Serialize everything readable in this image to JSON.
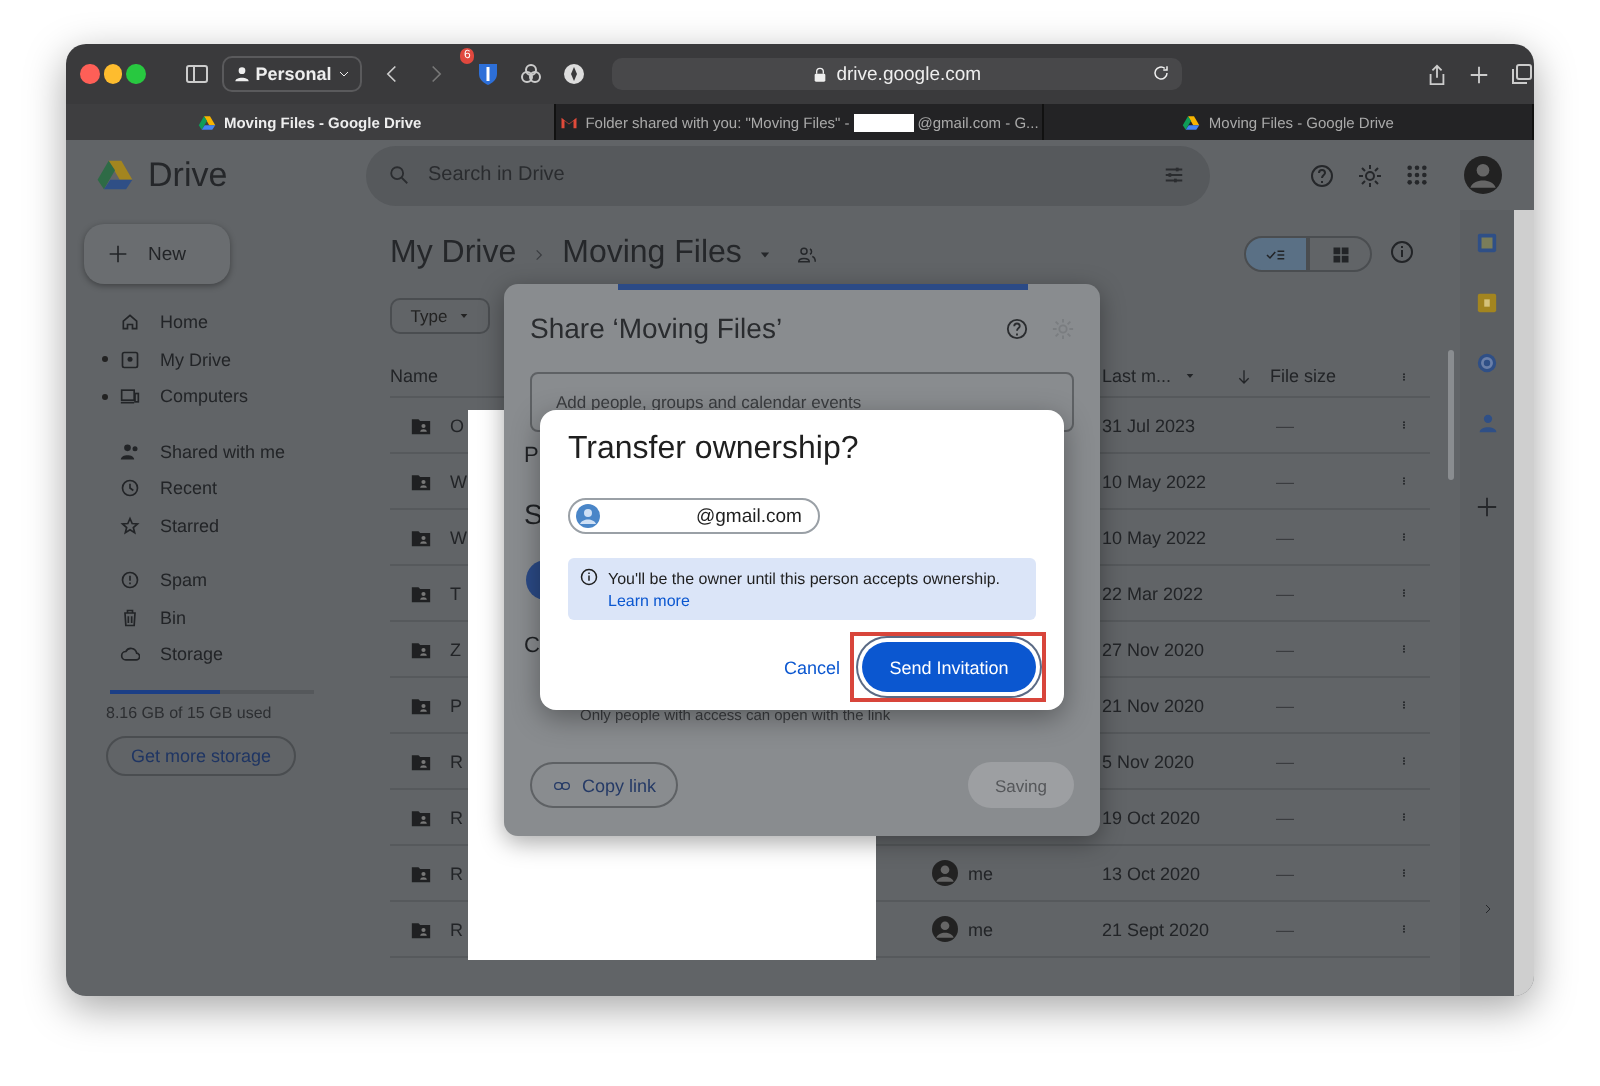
{
  "browser": {
    "profile": "Personal",
    "extension_badge": "6",
    "address": "drive.google.com"
  },
  "tabs": [
    {
      "title": "Moving Files - Google Drive",
      "selected": true
    },
    {
      "title": "Folder shared with you: \"Moving Files\" -",
      "title_after_redaction": "@gmail.com - G...",
      "selected": false
    },
    {
      "title": "Moving Files - Google Drive",
      "selected": false
    }
  ],
  "drive": {
    "app_name": "Drive",
    "search_placeholder": "Search in Drive",
    "new_button": "New",
    "nav_groups": [
      [
        {
          "label": "Home",
          "has_children": false
        },
        {
          "label": "My Drive",
          "has_children": true
        },
        {
          "label": "Computers",
          "has_children": true
        }
      ],
      [
        {
          "label": "Shared with me",
          "has_children": false
        },
        {
          "label": "Recent",
          "has_children": false
        },
        {
          "label": "Starred",
          "has_children": false
        }
      ],
      [
        {
          "label": "Spam",
          "has_children": false
        },
        {
          "label": "Bin",
          "has_children": false
        },
        {
          "label": "Storage",
          "has_children": false
        }
      ]
    ],
    "storage": {
      "level": 0.54,
      "usage": "8.16 GB of 15 GB used",
      "button": "Get more storage"
    },
    "breadcrumb": [
      "My Drive",
      "Moving Files"
    ],
    "filter": "Type",
    "views": [
      {
        "selected": true
      },
      {
        "selected": false
      }
    ],
    "columns": {
      "name": "Name",
      "modified": "Last m...",
      "size": "File size"
    },
    "rows": [
      {
        "name": "O",
        "modified": "31 Jul 2023",
        "size": "—"
      },
      {
        "name": "W",
        "modified": "10 May 2022",
        "size": "—"
      },
      {
        "name": "W",
        "modified": "10 May 2022",
        "size": "—"
      },
      {
        "name": "T",
        "modified": "22 Mar 2022",
        "size": "—"
      },
      {
        "name": "Z",
        "modified": "27 Nov 2020",
        "size": "—"
      },
      {
        "name": "P",
        "modified": "21 Nov 2020",
        "size": "—"
      },
      {
        "name": "R",
        "modified": "5 Nov 2020",
        "size": "—"
      },
      {
        "name": "R",
        "modified": "19 Oct 2020",
        "size": "—"
      },
      {
        "name": "R",
        "owner": "me",
        "modified": "13 Oct 2020",
        "size": "—"
      },
      {
        "name": "R",
        "owner": "me",
        "modified": "21 Sept 2020",
        "size": "—"
      }
    ]
  },
  "share_dialog": {
    "title": "Share ‘Moving Files’",
    "add_placeholder": "Add people, groups and calendar events",
    "loading": true,
    "fragments": [
      "P",
      "S",
      "C"
    ],
    "access_note": "Only people with access can open with the link",
    "copy_link": "Copy link",
    "done_button": {
      "label": "Saving",
      "disabled": true
    }
  },
  "transfer_dialog": {
    "title": "Transfer ownership?",
    "recipient": "@gmail.com",
    "notice": "You'll be the owner until this person accepts ownership.",
    "link": "Learn more",
    "cancel": "Cancel",
    "confirm": "Send Invitation",
    "highlighted": true
  }
}
